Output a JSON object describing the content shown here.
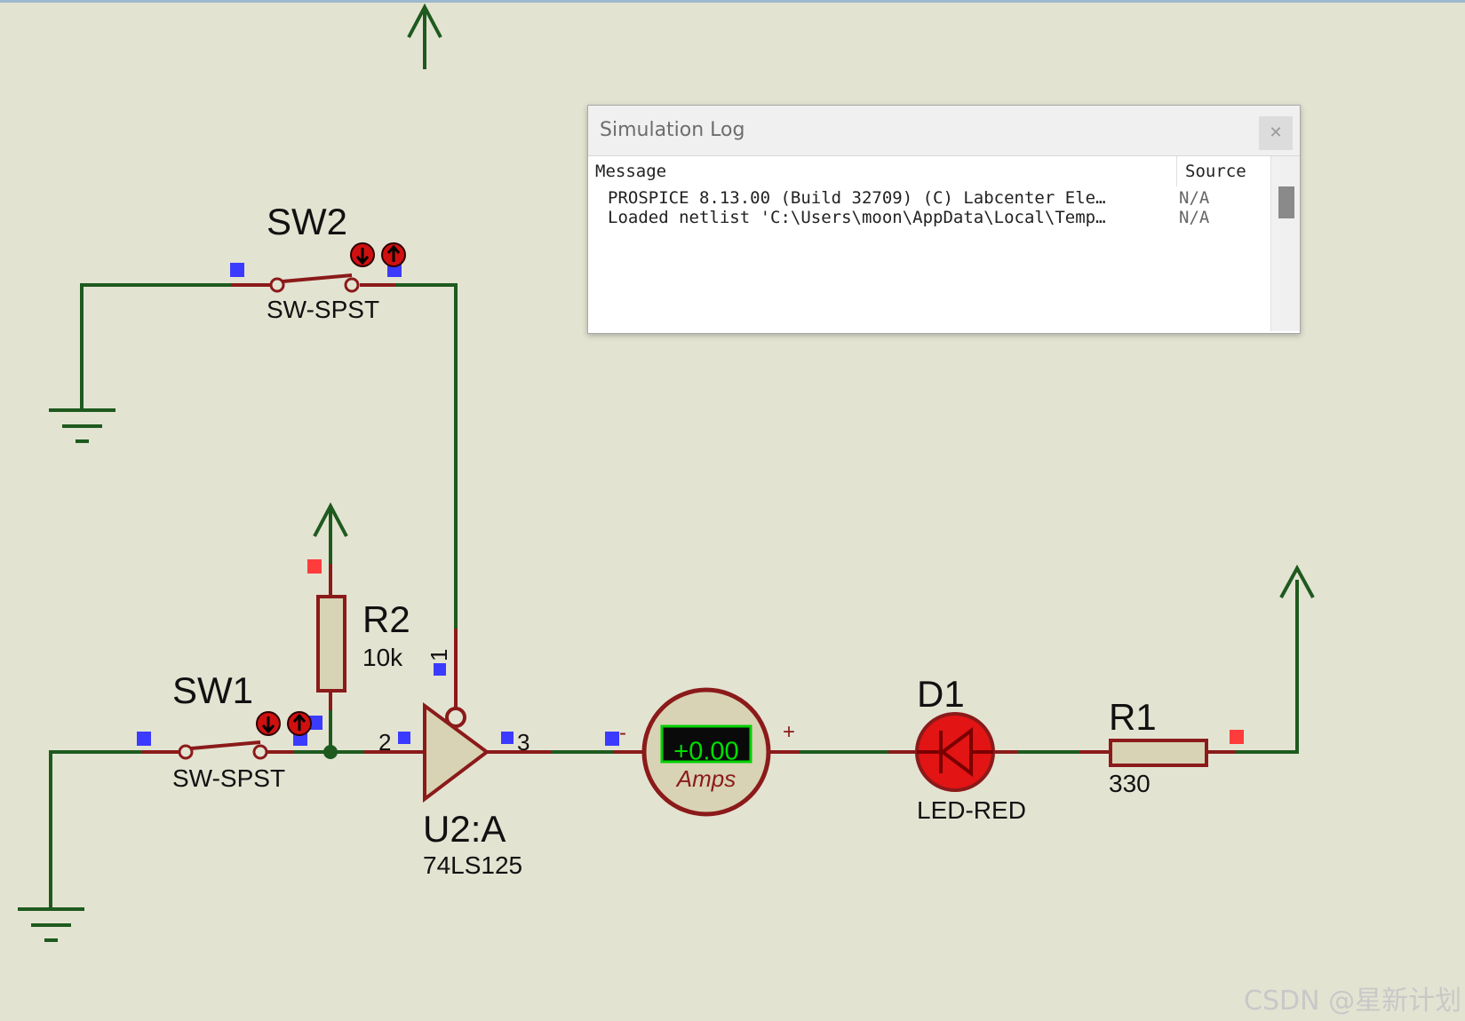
{
  "schematic": {
    "components": {
      "sw2": {
        "ref": "SW2",
        "value": "SW-SPST"
      },
      "sw1": {
        "ref": "SW1",
        "value": "SW-SPST"
      },
      "r2": {
        "ref": "R2",
        "value": "10k"
      },
      "u2": {
        "ref": "U2:A",
        "value": "74LS125",
        "pin_in": "2",
        "pin_out": "3",
        "pin_enable": "1"
      },
      "ammeter": {
        "reading": "+0.00",
        "unit": "Amps",
        "plus": "+",
        "minus": "-"
      },
      "d1": {
        "ref": "D1",
        "value": "LED-RED"
      },
      "r1": {
        "ref": "R1",
        "value": "330"
      }
    },
    "colors": {
      "wire": "#1e5a1e",
      "component_lead": "#8b1a1a",
      "body_fill": "#d8d3b5",
      "pin_blue": "#3b3bff",
      "pin_red": "#ff3c3c",
      "led_fill": "#e21414",
      "meter_display": "#00d000"
    }
  },
  "simulation_log": {
    "title": "Simulation Log",
    "close_icon": "close-icon",
    "columns": [
      "Message",
      "Source"
    ],
    "rows": [
      {
        "message": "PROSPICE 8.13.00 (Build 32709) (C) Labcenter Ele…",
        "source": "N/A"
      },
      {
        "message": "Loaded netlist 'C:\\Users\\moon\\AppData\\Local\\Temp…",
        "source": "N/A"
      }
    ]
  },
  "watermark": "CSDN @星新计划"
}
